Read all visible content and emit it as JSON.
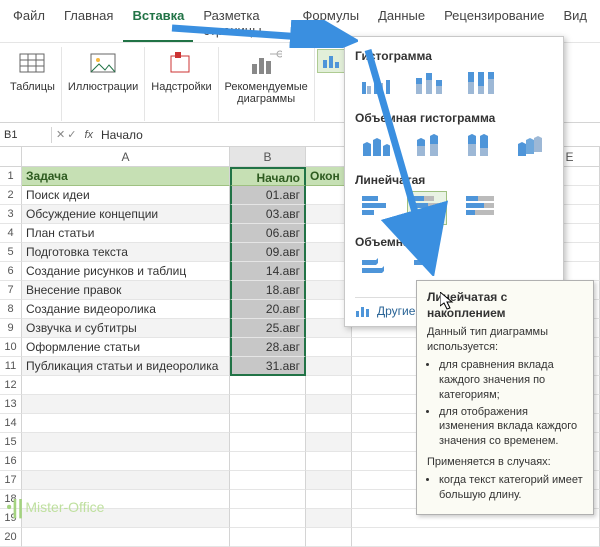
{
  "menu": {
    "items": [
      "Файл",
      "Главная",
      "Вставка",
      "Разметка страницы",
      "Формулы",
      "Данные",
      "Рецензирование",
      "Вид"
    ],
    "active_index": 2
  },
  "ribbon": {
    "tables": "Таблицы",
    "illustrations": "Иллюстрации",
    "addins": "Надстройки",
    "rec_charts": "Рекомендуемые\nдиаграммы"
  },
  "formula": {
    "namebox": "B1",
    "fx": "fx",
    "text": "Начало"
  },
  "columns": [
    "A",
    "B",
    "E"
  ],
  "headers": {
    "task": "Задача",
    "start": "Начало",
    "end": "Окон"
  },
  "rows": [
    {
      "n": 1
    },
    {
      "n": 2,
      "task": "Поиск идеи",
      "start": "01.авг"
    },
    {
      "n": 3,
      "task": "Обсуждение концепции",
      "start": "03.авг"
    },
    {
      "n": 4,
      "task": "План статьи",
      "start": "06.авг"
    },
    {
      "n": 5,
      "task": "Подготовка текста",
      "start": "09.авг"
    },
    {
      "n": 6,
      "task": "Создание рисунков и таблиц",
      "start": "14.авг"
    },
    {
      "n": 7,
      "task": "Внесение правок",
      "start": "18.авг"
    },
    {
      "n": 8,
      "task": "Создание видеоролика",
      "start": "20.авг"
    },
    {
      "n": 9,
      "task": "Озвучка и субтитры",
      "start": "25.авг"
    },
    {
      "n": 10,
      "task": "Оформление статьи",
      "start": "28.авг"
    },
    {
      "n": 11,
      "task": "Публикация статьи и видеоролика",
      "start": "31.авг"
    },
    {
      "n": 12
    },
    {
      "n": 13
    },
    {
      "n": 14
    },
    {
      "n": 15
    },
    {
      "n": 16
    },
    {
      "n": 17
    },
    {
      "n": 18
    },
    {
      "n": 19
    },
    {
      "n": 20
    }
  ],
  "chart_panel": {
    "s1": "Гистограмма",
    "s2": "Объемная гистограмма",
    "s3": "Линейчатая",
    "s4": "Объемная л",
    "other": "Другие г"
  },
  "tooltip": {
    "title": "Линейчатая с накоплением",
    "p1": "Данный тип диаграммы используется:",
    "b1": "для сравнения вклада каждого значения по категориям;",
    "b2": "для отображения изменения вклада каждого значения со временем.",
    "p2": "Применяется в случаях:",
    "b3": "когда текст категорий имеет большую длину."
  },
  "watermark": "Mister-Office"
}
